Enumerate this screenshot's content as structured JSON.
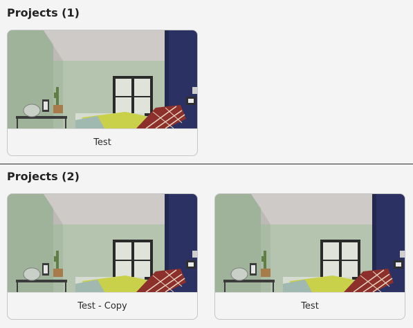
{
  "sections": [
    {
      "title": "Projects (1)",
      "projects": [
        {
          "name": "Test"
        }
      ]
    },
    {
      "title": "Projects (2)",
      "projects": [
        {
          "name": "Test - Copy"
        },
        {
          "name": "Test"
        }
      ]
    }
  ],
  "colors": {
    "background": "#f4f4f4",
    "wall_green": "#a9bba4",
    "accent_wall_navy": "#2c3164",
    "ceiling": "#cdcac7",
    "bedding_yellow": "#c9d04a",
    "divider": "#2b2b2b"
  }
}
